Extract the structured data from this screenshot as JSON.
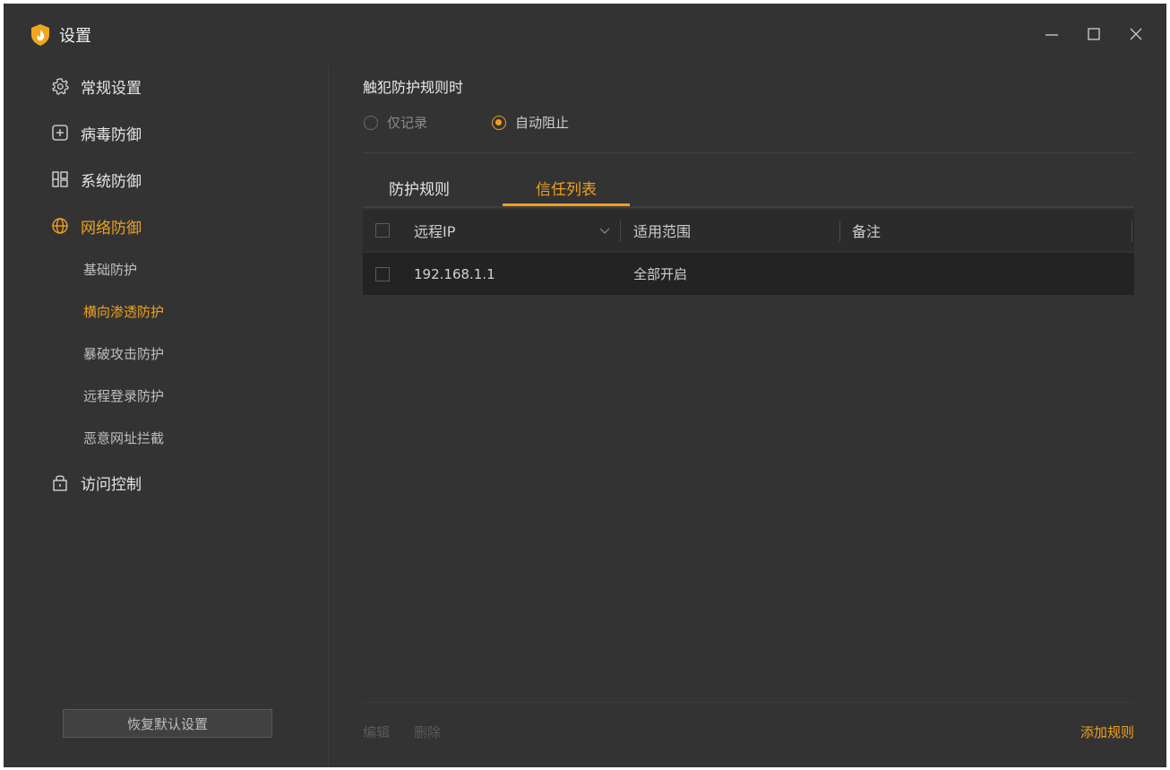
{
  "window": {
    "title": "设置",
    "controls": {
      "minimize": "minimize-icon",
      "maximize": "maximize-icon",
      "close": "close-icon"
    }
  },
  "colors": {
    "accent": "#f0a01e",
    "background": "#333333",
    "row": "#232323"
  },
  "sidebar": {
    "items": [
      {
        "label": "常规设置",
        "icon": "gear-icon"
      },
      {
        "label": "病毒防御",
        "icon": "plus-square-icon"
      },
      {
        "label": "系统防御",
        "icon": "layout-icon"
      },
      {
        "label": "网络防御",
        "icon": "globe-icon",
        "active": true
      },
      {
        "label": "访问控制",
        "icon": "lock-icon"
      }
    ],
    "subitems": [
      {
        "label": "基础防护"
      },
      {
        "label": "横向渗透防护",
        "active": true
      },
      {
        "label": "暴破攻击防护"
      },
      {
        "label": "远程登录防护"
      },
      {
        "label": "恶意网址拦截"
      }
    ],
    "reset_label": "恢复默认设置"
  },
  "main": {
    "section_title": "触犯防护规则时",
    "radios": [
      {
        "label": "仅记录",
        "checked": false
      },
      {
        "label": "自动阻止",
        "checked": true
      }
    ],
    "tabs": [
      {
        "label": "防护规则",
        "active": false
      },
      {
        "label": "信任列表",
        "active": true
      }
    ],
    "table": {
      "columns": [
        "远程IP",
        "适用范围",
        "备注"
      ],
      "rows": [
        {
          "ip": "192.168.1.1",
          "scope": "全部开启",
          "note": ""
        }
      ]
    },
    "footer": {
      "edit": "编辑",
      "delete": "删除",
      "add": "添加规则"
    }
  }
}
